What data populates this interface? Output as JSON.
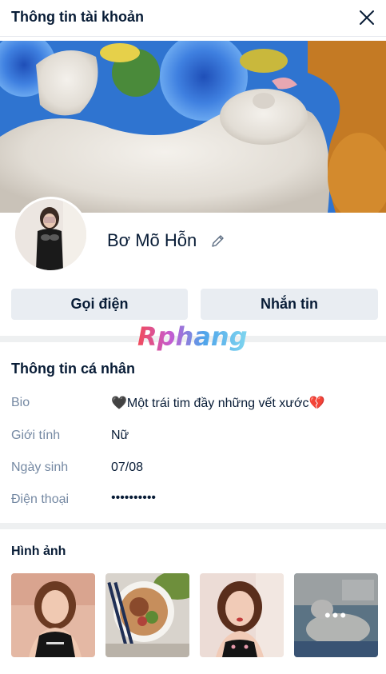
{
  "header": {
    "title": "Thông tin tài khoản"
  },
  "profile": {
    "name": "Bơ Mõ Hỗn"
  },
  "actions": {
    "call_label": "Gọi điện",
    "message_label": "Nhắn tin"
  },
  "watermark": {
    "text": "Rphang"
  },
  "personal": {
    "title": "Thông tin cá nhân",
    "rows": [
      {
        "label": "Bio",
        "value": "🖤Một trái tim đầy những vết xước💔"
      },
      {
        "label": "Giới tính",
        "value": "Nữ"
      },
      {
        "label": "Ngày sinh",
        "value": "07/08"
      },
      {
        "label": "Điện thoại",
        "value": "••••••••••"
      }
    ]
  },
  "photos": {
    "title": "Hình ảnh",
    "more_label": "•••"
  },
  "colors": {
    "text": "#081c36",
    "label": "#7589a3",
    "button_bg": "#e9edf2",
    "separator": "#eef0f1"
  }
}
